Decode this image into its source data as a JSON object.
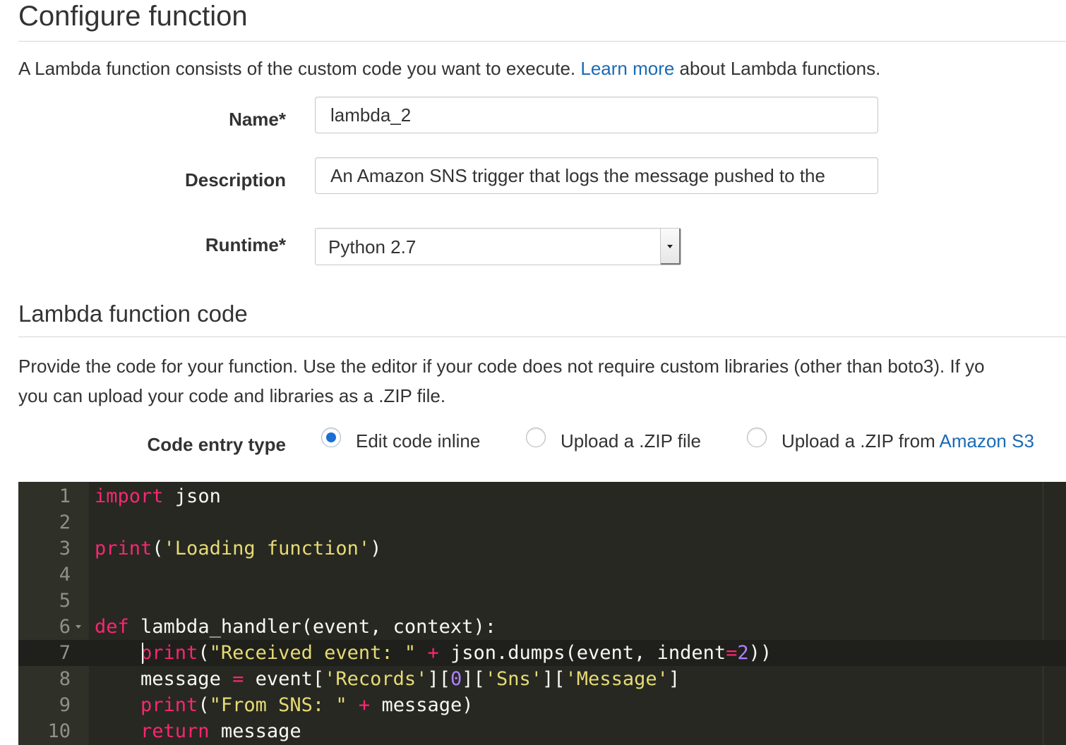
{
  "page": {
    "title": "Configure function",
    "intro": {
      "before": "A Lambda function consists of the custom code you want to execute. ",
      "link": "Learn more",
      "after": " about Lambda functions."
    }
  },
  "form": {
    "name": {
      "label": "Name*",
      "value": "lambda_2"
    },
    "description": {
      "label": "Description",
      "value": "An Amazon SNS trigger that logs the message pushed to the"
    },
    "runtime": {
      "label": "Runtime*",
      "value": "Python 2.7"
    }
  },
  "code_section": {
    "title": "Lambda function code",
    "para_line1": "Provide the code for your function. Use the editor if your code does not require custom libraries (other than boto3). If yo",
    "para_line2": "you can upload your code and libraries as a .ZIP file.",
    "entry_type": {
      "label": "Code entry type",
      "options": [
        {
          "label": "Edit code inline",
          "checked": true
        },
        {
          "label": "Upload a .ZIP file",
          "checked": false
        },
        {
          "label": "Upload a .ZIP from ",
          "link": "Amazon S3",
          "checked": false
        }
      ]
    }
  },
  "editor": {
    "active_line": 7,
    "lines": [
      {
        "n": "1"
      },
      {
        "n": "2"
      },
      {
        "n": "3"
      },
      {
        "n": "4"
      },
      {
        "n": "5"
      },
      {
        "n": "6"
      },
      {
        "n": "7"
      },
      {
        "n": "8"
      },
      {
        "n": "9"
      },
      {
        "n": "10"
      }
    ],
    "tokens": {
      "l1_kw": "import",
      "l1_rest": " json",
      "l3_kw": "print",
      "l3_p1": "(",
      "l3_str": "'Loading function'",
      "l3_p2": ")",
      "l6_kw": "def",
      "l6_rest": " lambda_handler(event, context):",
      "l7_ind": "    ",
      "l7_kw": "print",
      "l7_p1": "(",
      "l7_str": "\"Received event: \"",
      "l7_op": " + ",
      "l7_mid": "json.dumps(event, indent",
      "l7_eq": "=",
      "l7_num": "2",
      "l7_end": "))",
      "l8_ind": "    ",
      "l8_a": "message ",
      "l8_eq": "=",
      "l8_b": " event[",
      "l8_s1": "'Records'",
      "l8_c": "][",
      "l8_n": "0",
      "l8_d": "][",
      "l8_s2": "'Sns'",
      "l8_e": "][",
      "l8_s3": "'Message'",
      "l8_f": "]",
      "l9_ind": "    ",
      "l9_kw": "print",
      "l9_p1": "(",
      "l9_str": "\"From SNS: \"",
      "l9_op": " + ",
      "l9_rest": "message)",
      "l10_ind": "    ",
      "l10_kw": "return",
      "l10_rest": " message"
    },
    "colors": {
      "background": "#272822",
      "keyword": "#f92672",
      "string": "#e6db74",
      "number": "#ae81ff"
    }
  },
  "colors": {
    "link": "#1a6bb5",
    "radio_checked": "#1a6fd2"
  }
}
